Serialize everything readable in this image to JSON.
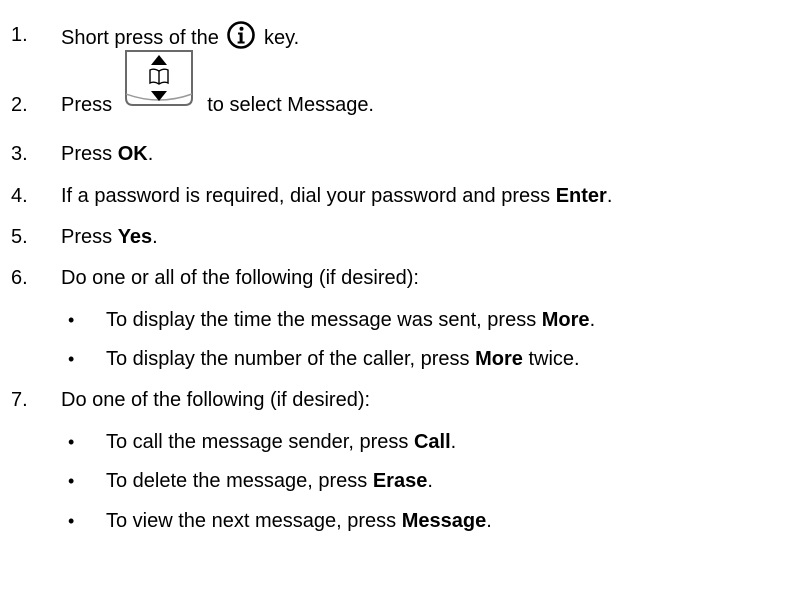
{
  "steps": [
    {
      "num": "1.",
      "pre": "Short press of the ",
      "post": " key."
    },
    {
      "num": "2.",
      "pre": "Press ",
      "post": " to select Message."
    },
    {
      "num": "3.",
      "pre": "Press ",
      "bold": "OK",
      "post": "."
    },
    {
      "num": "4.",
      "pre": "If a password is required, dial your password and press ",
      "bold": "Enter",
      "post": "."
    },
    {
      "num": "5.",
      "pre": "Press ",
      "bold": "Yes",
      "post": "."
    },
    {
      "num": "6.",
      "pre": "Do one or all of the following (if desired):"
    },
    {
      "num": "7.",
      "pre": "Do one of the following (if desired):"
    }
  ],
  "step6_bullets": [
    {
      "pre": "To display the time the message was sent, press ",
      "bold": "More",
      "post": "."
    },
    {
      "pre": "To display the number of the caller, press ",
      "bold": "More",
      "post": " twice."
    }
  ],
  "step7_bullets": [
    {
      "pre": "To call the message sender, press ",
      "bold": "Call",
      "post": "."
    },
    {
      "pre": "To delete the message, press ",
      "bold": "Erase",
      "post": "."
    },
    {
      "pre": "To view the next message, press ",
      "bold": "Message",
      "post": "."
    }
  ],
  "bullet_char": "•",
  "icons": {
    "info_key": "info-circle-icon",
    "nav_key": "up-down-phonebook-key-icon"
  }
}
